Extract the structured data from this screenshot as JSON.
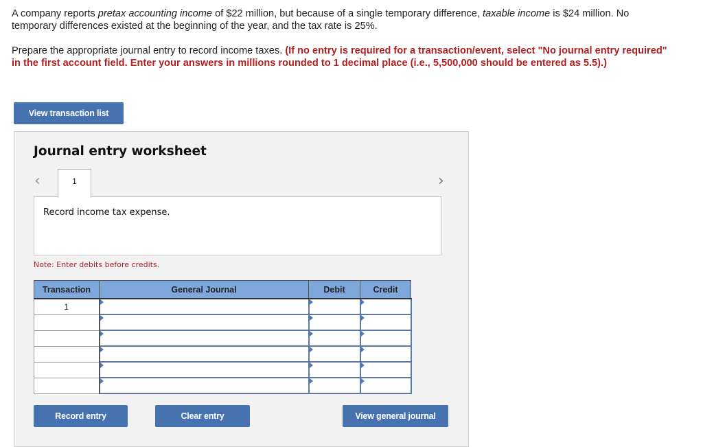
{
  "question": {
    "p1_a": "A company reports ",
    "p1_i1": "pretax accounting income",
    "p1_b": " of $22 million, but because of a single temporary difference, ",
    "p1_i2": "taxable income",
    "p1_c": " is $24 million. No temporary differences existed at the beginning of the year, and the tax rate is 25%.",
    "p2_plain": "Prepare the appropriate journal entry to record income taxes. ",
    "p2_red": "(If no entry is required for a transaction/event, select \"No journal entry required\" in the first account field. Enter your answers in millions rounded to 1 decimal place (i.e., 5,500,000 should be entered as 5.5).)"
  },
  "buttons": {
    "view_transaction_list": "View transaction list",
    "record_entry": "Record entry",
    "clear_entry": "Clear entry",
    "view_general_journal": "View general journal"
  },
  "worksheet": {
    "title": "Journal entry worksheet",
    "prev_icon": "‹",
    "next_icon": "›",
    "active_tab": "1",
    "description": "Record income tax expense.",
    "note": "Note: Enter debits before credits."
  },
  "table": {
    "headers": [
      "Transaction",
      "General Journal",
      "Debit",
      "Credit"
    ],
    "rows": [
      {
        "transaction": "1",
        "account": "",
        "debit": "",
        "credit": ""
      },
      {
        "transaction": "",
        "account": "",
        "debit": "",
        "credit": ""
      },
      {
        "transaction": "",
        "account": "",
        "debit": "",
        "credit": ""
      },
      {
        "transaction": "",
        "account": "",
        "debit": "",
        "credit": ""
      },
      {
        "transaction": "",
        "account": "",
        "debit": "",
        "credit": ""
      },
      {
        "transaction": "",
        "account": "",
        "debit": "",
        "credit": ""
      }
    ]
  },
  "colors": {
    "button_bg": "#4673b0",
    "header_bg": "#7ea7dc",
    "instruction_red": "#b02020",
    "panel_bg": "#f2f2f2"
  }
}
